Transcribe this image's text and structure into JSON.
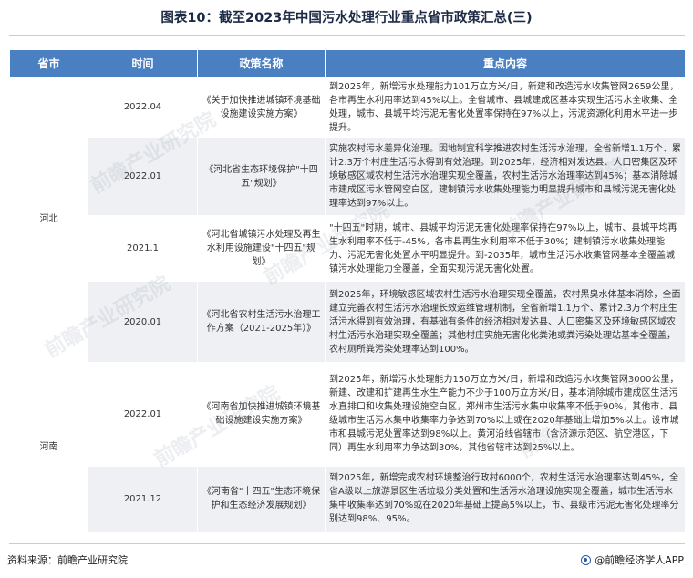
{
  "title": "图表10：截至2023年中国污水处理行业重点省市政策汇总(三)",
  "headers": {
    "province": "省市",
    "time": "时间",
    "policy": "政策名称",
    "content": "重点内容"
  },
  "groups": [
    {
      "province": "河北",
      "rows": [
        {
          "time": "2022.04",
          "policy": "《关于加快推进城镇环境基础设施建设实施方案》",
          "content": "到2025年，新增污水处理能力101万立方米/日，新建和改造污水收集管网2659公里，各市再生水利用率达到45%以上。全省城市、县城建成区基本实现生活污水全收集、全处理，城市、县城平均污泥无害化处置率保持在97%以上，污泥资源化利用水平进一步提升。"
        },
        {
          "time": "2022.01",
          "policy": "《河北省生态环境保护\"十四五\"规划》",
          "content": "实施农村污水差异化治理。因地制宜科学推进农村生活污水治理，全省新增1.1万个、累计2.3万个村庄生活污水得到有效治理。到2025年，经济相对发达县、人口密集区及环境敏感区域农村生活污水治理实现全覆盖，农村生活污水治理率达到45%；基本消除城市建成区污水管网空白区，建制镇污水收集处理能力明显提升城市和县城污泥无害化处理率达到97%以上。"
        },
        {
          "time": "2021.1",
          "policy": "《河北省城镇污水处理及再生水利用设施建设\"十四五\"规划》",
          "content": "\"十四五\"时期，城市、县城平均污泥无害化处理率保持在97%以上，城市、县城平均再生水利用率不低于-45%，各市县再生水利用率不低于30%；建制镇污水收集处理能力、污泥无害化处置水平明显提升。到-2035年，城市生活污水收集管网基本全覆盖城镇污水处理能力全覆盖，全面实现污泥无害化处置。"
        },
        {
          "time": "2020.01",
          "policy": "《河北省农村生活污水治理工作方案（2021-2025年）》",
          "content": "到2025年，环境敏感区域农村生活污水治理实现全覆盖，农村黑臭水体基本消除，全面建立完善农村生活污水治理长效运维管理机制，全省新增1.1万个、累计2.3万个村庄生活污水得到有效治理，有基础有条件的经济相对发达县、人口密集区及环境敏感区域农村生活污水治理实现全覆盖；其他村庄实施无害化化粪池或粪污染处理站基本全覆盖，农村厕所粪污染处理率达到100%。"
        }
      ]
    },
    {
      "province": "河南",
      "rows": [
        {
          "time": "2022.01",
          "policy": "《河南省加快推进城镇环境基础设施建设实施方案》",
          "content": "到2025年，新增污水处理能力150万立方米/日，新增和改造污水收集管网3000公里，新建、改建和扩建再生水生产能力不少于100万立方米/日，基本消除城市建成区生活污水直排口和收集处理设施空白区，郑州市生活污水集中收集率不低于90%，其他市、县级城市生活污水集中收集率力争达到70%以上或在2020年基础上增加5%以上。设市城市和县城污泥处置率达到98%以上。黄河沿线省辖市（含济源示范区、航空港区，下同）再生水利用率力争达到30%，其他省辖市达到25%以上。"
        },
        {
          "time": "2021.12",
          "policy": "《河南省\"十四五\"生态环境保护和生态经济发展规划》",
          "content": "到2025年，新增完成农村环境整治行政村6000个，农村生活污水治理率达到45%，全省A级以上旅游景区生活垃圾分类处置和生活污水治理设施实现全覆盖，城市生活污水集中收集率达到70%或在2020年基础上提高5%以上，市、县级市污泥无害化处理率分别达到98%、95%。"
        }
      ]
    }
  ],
  "footer": {
    "source": "资料来源：前瞻产业研究院",
    "brand": "@前瞻经济学人APP",
    "brand_icon": "qianzhan-logo-icon"
  },
  "watermark_text": "前瞻产业研究院",
  "colors": {
    "header_bg": "#4a7fc2",
    "stripe": "#eef0f3",
    "title": "#1c2a45"
  }
}
